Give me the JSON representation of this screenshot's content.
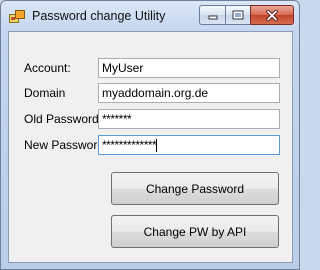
{
  "window": {
    "title": "Password change Utility"
  },
  "form": {
    "account_label": "Account:",
    "account_value": "MyUser",
    "domain_label": "Domain",
    "domain_value": "myaddomain.org.de",
    "old_password_label": "Old Password:",
    "old_password_value": "*******",
    "new_password_label": "New Password:",
    "new_password_value": "*************"
  },
  "buttons": {
    "change_password": "Change Password",
    "change_pw_api": "Change PW by API"
  },
  "colors": {
    "close_button": "#c2442a",
    "focus_border": "#5a9bd8",
    "client_background": "#f0f0f0"
  }
}
